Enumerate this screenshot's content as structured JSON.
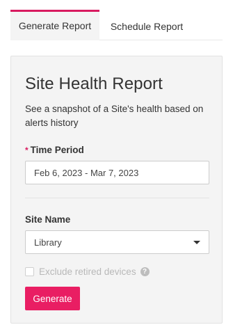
{
  "tabs": [
    {
      "label": "Generate Report",
      "active": true
    },
    {
      "label": "Schedule Report",
      "active": false
    }
  ],
  "form": {
    "title": "Site Health Report",
    "description": "See a snapshot of a Site's health based on alerts history",
    "time_period": {
      "label": "Time Period",
      "required_marker": "*",
      "value": "Feb 6, 2023 - Mar 7, 2023"
    },
    "site_name": {
      "label": "Site Name",
      "selected": "Library"
    },
    "exclude_retired": {
      "label": "Exclude retired devices",
      "checked": false,
      "disabled": true,
      "help_icon": "question-circle-icon",
      "help_glyph": "?"
    },
    "generate_label": "Generate"
  },
  "colors": {
    "accent": "#e91e63",
    "tab_indicator": "#d81b60",
    "panel_bg": "#f4f4f4"
  }
}
